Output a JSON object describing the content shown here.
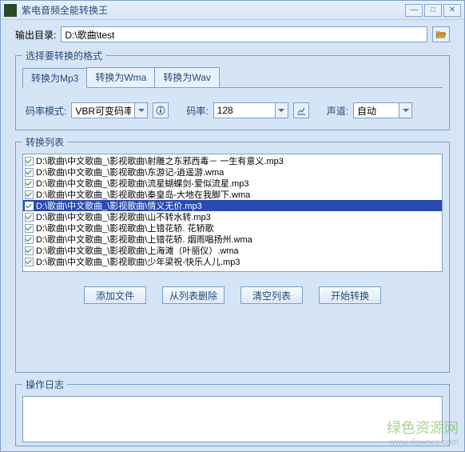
{
  "window": {
    "title": "紫电音频全能转换王"
  },
  "output": {
    "label": "输出目录:",
    "path": "D:\\歌曲\\test"
  },
  "format_group": {
    "legend": "选择要转换的格式",
    "tabs": [
      "转换为Mp3",
      "转换为Wma",
      "转换为Wav"
    ],
    "active_tab": 0,
    "bitrate_mode_label": "码率模式:",
    "bitrate_mode_value": "VBR可变码率",
    "bitrate_label": "码率:",
    "bitrate_value": "128",
    "channel_label": "声道:",
    "channel_value": "自动"
  },
  "list": {
    "legend": "转换列表",
    "selected_index": 3,
    "items": [
      "D:\\歌曲\\中文歌曲_\\影视歌曲\\射雕之东邪西毒－ 一生有意义.mp3",
      "D:\\歌曲\\中文歌曲_\\影视歌曲\\东游记-逍遥游.wma",
      "D:\\歌曲\\中文歌曲_\\影视歌曲\\流星蝴蝶剑-爱似流星.mp3",
      "D:\\歌曲\\中文歌曲_\\影视歌曲\\秦皇岛-大地在我脚下.wma",
      "D:\\歌曲\\中文歌曲_\\影视歌曲\\情义无价.mp3",
      "D:\\歌曲\\中文歌曲_\\影视歌曲\\山不转水转.mp3",
      "D:\\歌曲\\中文歌曲_\\影视歌曲\\上错花轿. 花轿歌",
      "D:\\歌曲\\中文歌曲_\\影视歌曲\\上错花轿. 烟雨唱扬州.wma",
      "D:\\歌曲\\中文歌曲_\\影视歌曲\\上海滩（叶丽仪）.wma",
      "D:\\歌曲\\中文歌曲_\\影视歌曲\\少年梁祝-快乐人儿.mp3"
    ]
  },
  "buttons": {
    "add": "添加文件",
    "remove": "从列表删除",
    "clear": "清空列表",
    "start": "开始转换"
  },
  "log": {
    "legend": "操作日志"
  },
  "watermark": {
    "line1": "绿色资源网",
    "line2": "www.downcc.com"
  }
}
